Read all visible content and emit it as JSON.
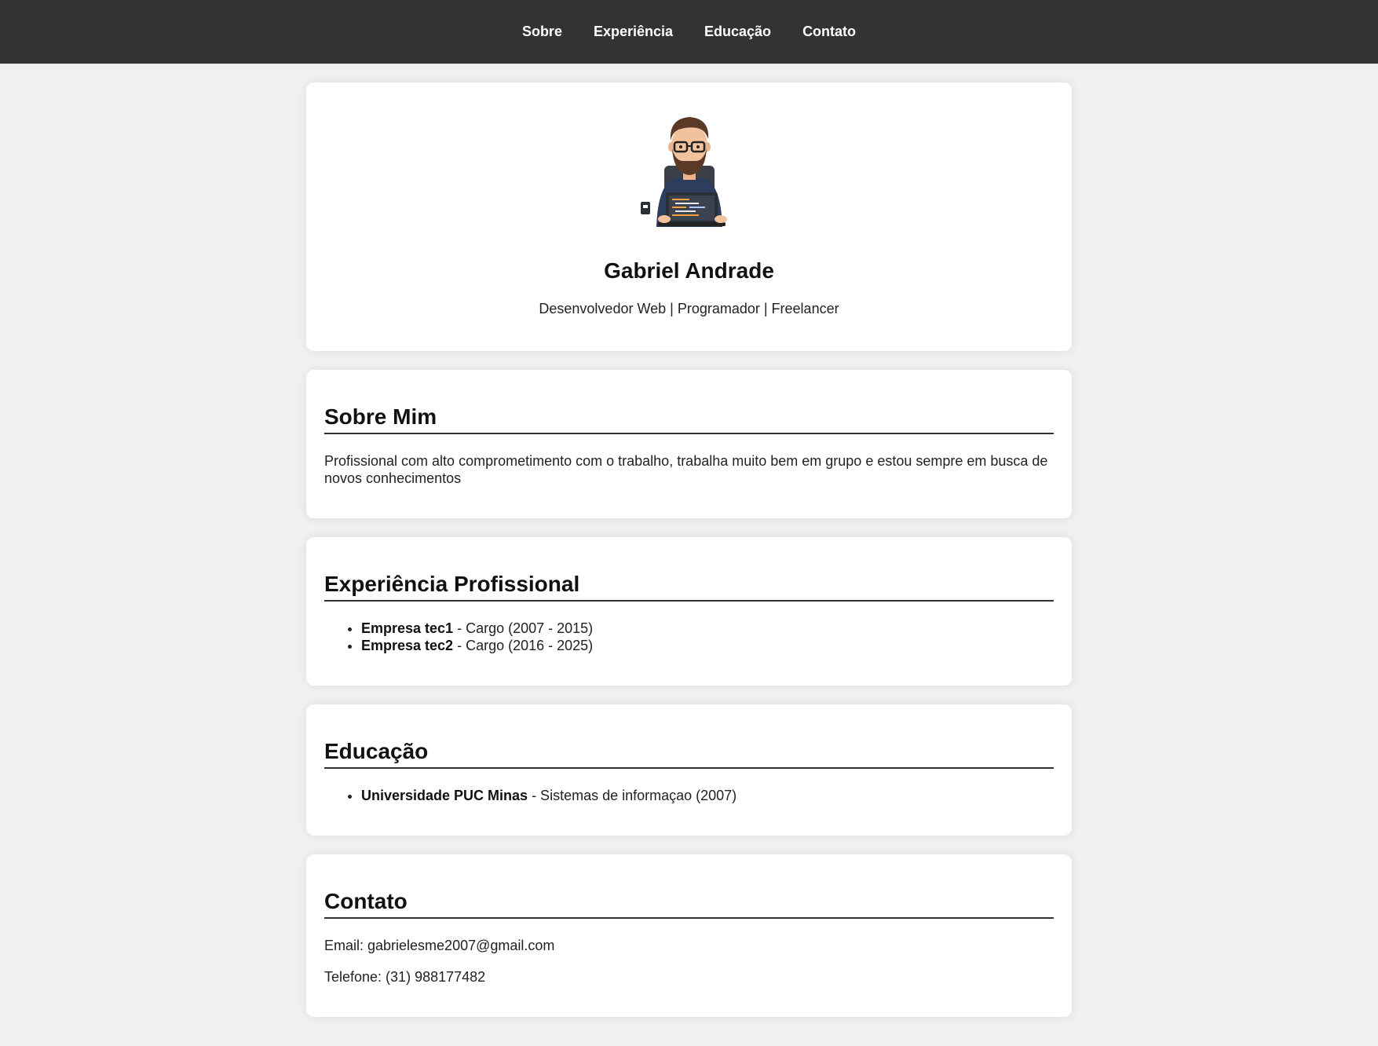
{
  "nav": {
    "items": [
      "Sobre",
      "Experiência",
      "Educação",
      "Contato"
    ]
  },
  "hero": {
    "avatar_icon": "developer-avatar-illustration",
    "name": "Gabriel Andrade",
    "subtitle": "Desenvolvedor Web | Programador | Freelancer"
  },
  "about": {
    "title": "Sobre Mim",
    "text": "Profissional com alto comprometimento com o trabalho, trabalha muito bem em grupo e estou sempre em busca de novos conhecimentos"
  },
  "experience": {
    "title": "Experiência Profissional",
    "items": [
      {
        "company": "Empresa tec1",
        "detail": " - Cargo (2007 - 2015)"
      },
      {
        "company": "Empresa tec2",
        "detail": " - Cargo (2016 - 2025)"
      }
    ]
  },
  "education": {
    "title": "Educação",
    "items": [
      {
        "institution": "Universidade PUC Minas",
        "detail": " - Sistemas de informaçao (2007)"
      }
    ]
  },
  "contact": {
    "title": "Contato",
    "email": "Email: gabrielesme2007@gmail.com",
    "phone": "Telefone: (31) 988177482"
  },
  "colors": {
    "nav_bg": "#333333",
    "page_bg": "#f0f0f0",
    "card_bg": "#ffffff"
  }
}
